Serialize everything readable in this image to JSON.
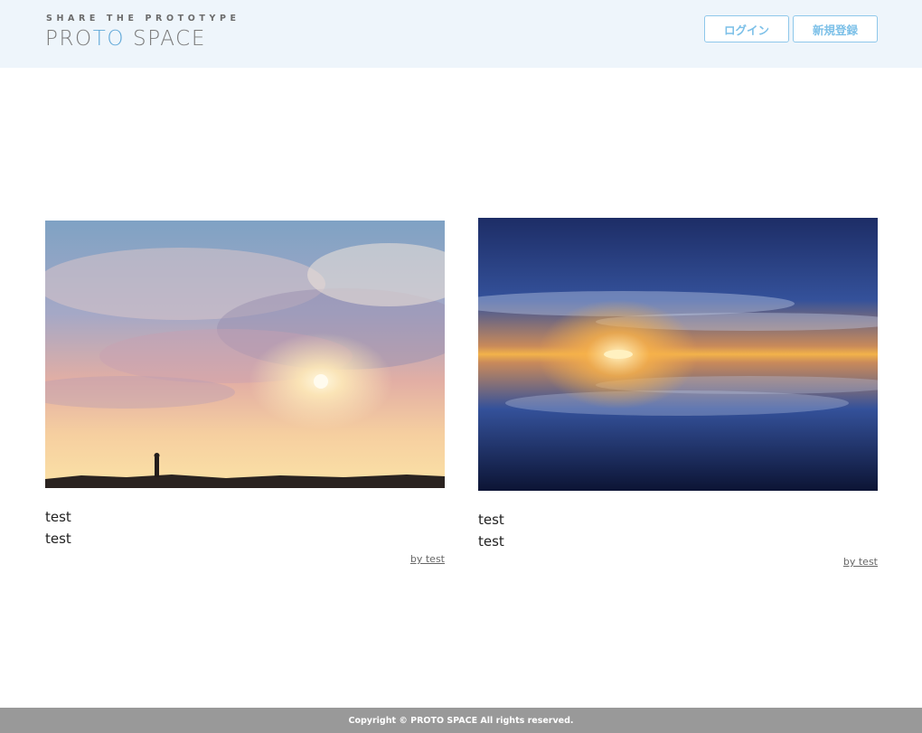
{
  "header": {
    "tagline": "SHARE THE PROTOTYPE",
    "logo_part1": "PRO",
    "logo_part2": "TO",
    "logo_part3": " SPACE",
    "login_label": "ログイン",
    "signup_label": "新規登録"
  },
  "prototypes": [
    {
      "title": "test",
      "catch_copy": "test",
      "user": "by test",
      "image": "sunset-fisherman-photo"
    },
    {
      "title": "test",
      "catch_copy": "test",
      "user": "by test",
      "image": "sunset-reflection-photo"
    }
  ],
  "footer": {
    "copyright": "Copyright © PROTO SPACE All rights reserved."
  },
  "colors": {
    "header_bg": "#eef5fb",
    "accent": "#7cc0e8",
    "footer_bg": "#999999"
  }
}
